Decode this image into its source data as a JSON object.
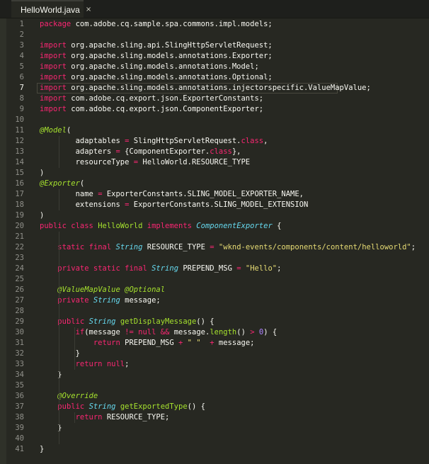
{
  "tab": {
    "filename": "HelloWorld.java",
    "close_glyph": "×"
  },
  "active_line": 7,
  "lines": [
    {
      "n": "1",
      "code": "package com.adobe.cq.sample.spa.commons.impl.models;"
    },
    {
      "n": "2",
      "code": ""
    },
    {
      "n": "3",
      "code": "import org.apache.sling.api.SlingHttpServletRequest;"
    },
    {
      "n": "4",
      "code": "import org.apache.sling.models.annotations.Exporter;"
    },
    {
      "n": "5",
      "code": "import org.apache.sling.models.annotations.Model;"
    },
    {
      "n": "6",
      "code": "import org.apache.sling.models.annotations.Optional;"
    },
    {
      "n": "7",
      "code": "import org.apache.sling.models.annotations.injectorspecific.ValueMapValue;"
    },
    {
      "n": "8",
      "code": "import com.adobe.cq.export.json.ExporterConstants;"
    },
    {
      "n": "9",
      "code": "import com.adobe.cq.export.json.ComponentExporter;"
    },
    {
      "n": "10",
      "code": ""
    },
    {
      "n": "11",
      "code": "@Model("
    },
    {
      "n": "12",
      "code": "        adaptables = SlingHttpServletRequest.class,"
    },
    {
      "n": "13",
      "code": "        adapters = {ComponentExporter.class},"
    },
    {
      "n": "14",
      "code": "        resourceType = HelloWorld.RESOURCE_TYPE"
    },
    {
      "n": "15",
      "code": ")"
    },
    {
      "n": "16",
      "code": "@Exporter("
    },
    {
      "n": "17",
      "code": "        name = ExporterConstants.SLING_MODEL_EXPORTER_NAME,"
    },
    {
      "n": "18",
      "code": "        extensions = ExporterConstants.SLING_MODEL_EXTENSION"
    },
    {
      "n": "19",
      "code": ")"
    },
    {
      "n": "20",
      "code": "public class HelloWorld implements ComponentExporter {"
    },
    {
      "n": "21",
      "code": ""
    },
    {
      "n": "22",
      "code": "    static final String RESOURCE_TYPE = \"wknd-events/components/content/helloworld\";"
    },
    {
      "n": "23",
      "code": ""
    },
    {
      "n": "24",
      "code": "    private static final String PREPEND_MSG = \"Hello\";"
    },
    {
      "n": "25",
      "code": ""
    },
    {
      "n": "26",
      "code": "    @ValueMapValue @Optional"
    },
    {
      "n": "27",
      "code": "    private String message;"
    },
    {
      "n": "28",
      "code": ""
    },
    {
      "n": "29",
      "code": "    public String getDisplayMessage() {"
    },
    {
      "n": "30",
      "code": "        if(message != null && message.length() > 0) {"
    },
    {
      "n": "31",
      "code": "            return PREPEND_MSG + \" \"  + message;"
    },
    {
      "n": "32",
      "code": "        }"
    },
    {
      "n": "33",
      "code": "        return null;"
    },
    {
      "n": "34",
      "code": "    }"
    },
    {
      "n": "35",
      "code": ""
    },
    {
      "n": "36",
      "code": "    @Override"
    },
    {
      "n": "37",
      "code": "    public String getExportedType() {"
    },
    {
      "n": "38",
      "code": "        return RESOURCE_TYPE;"
    },
    {
      "n": "39",
      "code": "    }"
    },
    {
      "n": "40",
      "code": ""
    },
    {
      "n": "41",
      "code": "}"
    }
  ]
}
